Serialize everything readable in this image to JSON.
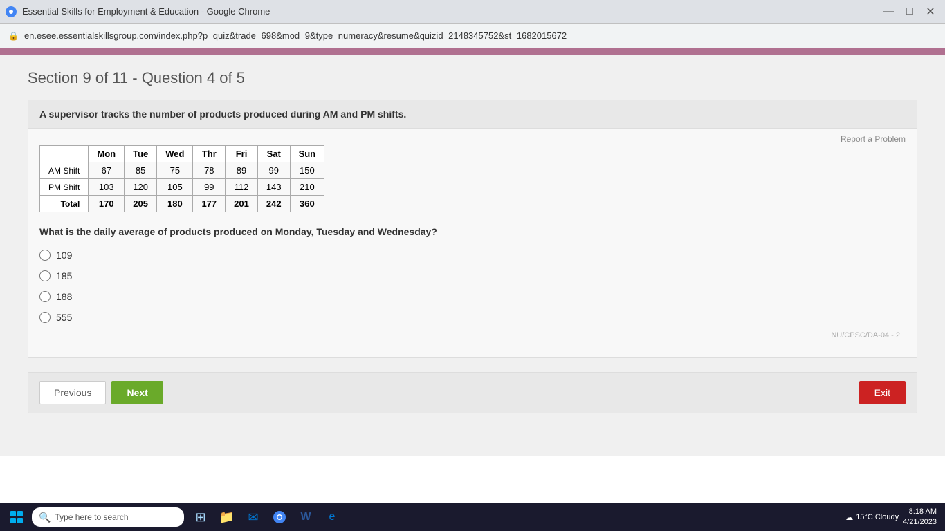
{
  "browser": {
    "title": "Essential Skills for Employment & Education - Google Chrome",
    "url": "en.esee.essentialskillsgroup.com/index.php?p=quiz&trade=698&mod=9&type=numeracy&resume&quizid=2148345752&st=1682015672",
    "controls": {
      "minimize": "—",
      "maximize": "□",
      "close": "✕"
    }
  },
  "page": {
    "section_title": "Section 9 of 11  -  Question 4 of 5",
    "intro_text": "A supervisor tracks the number of products produced during AM and PM shifts.",
    "report_link": "Report a Problem",
    "table": {
      "headers": [
        "",
        "Mon",
        "Tue",
        "Wed",
        "Thr",
        "Fri",
        "Sat",
        "Sun"
      ],
      "rows": [
        {
          "label": "AM Shift",
          "values": [
            "67",
            "85",
            "75",
            "78",
            "89",
            "99",
            "150"
          ]
        },
        {
          "label": "PM Shift",
          "values": [
            "103",
            "120",
            "105",
            "99",
            "112",
            "143",
            "210"
          ]
        },
        {
          "label": "Total",
          "values": [
            "170",
            "205",
            "180",
            "177",
            "201",
            "242",
            "360"
          ]
        }
      ]
    },
    "question_text": "What is the daily average of products produced on Monday, Tuesday and Wednesday?",
    "options": [
      {
        "id": "opt1",
        "value": "109",
        "label": "109"
      },
      {
        "id": "opt2",
        "value": "185",
        "label": "185"
      },
      {
        "id": "opt3",
        "value": "188",
        "label": "188"
      },
      {
        "id": "opt4",
        "value": "555",
        "label": "555"
      }
    ],
    "question_id": "NU/CPSC/DA-04 - 2"
  },
  "navigation": {
    "previous_label": "Previous",
    "next_label": "Next",
    "exit_label": "Exit"
  },
  "taskbar": {
    "search_placeholder": "Type here to search",
    "weather": "15°C  Cloudy",
    "time": "8:18 AM",
    "date": "4/21/2023"
  }
}
